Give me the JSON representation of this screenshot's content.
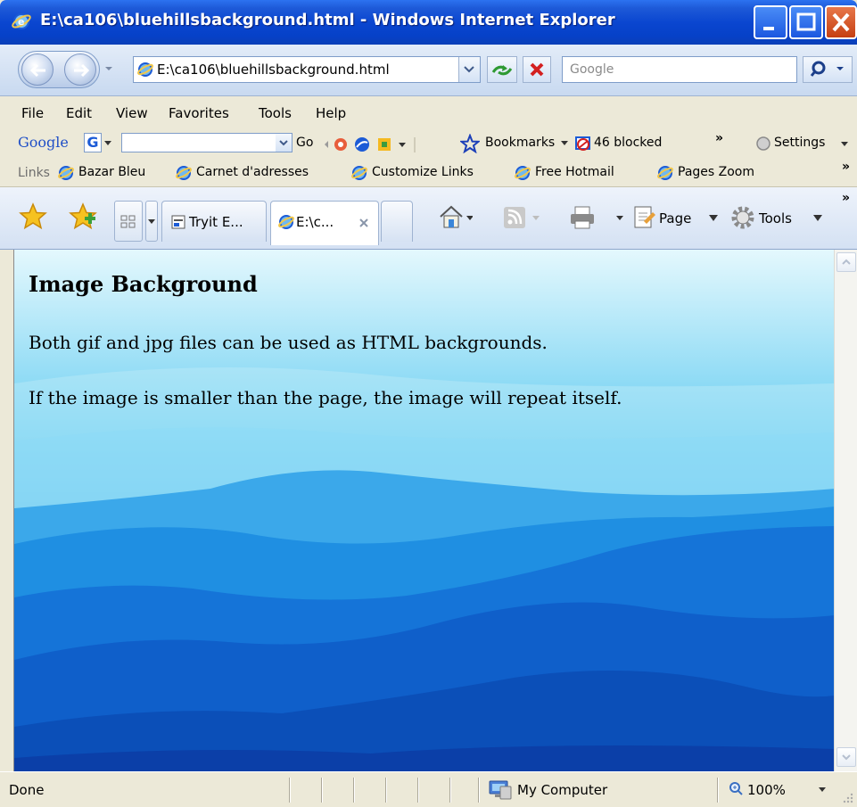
{
  "window": {
    "title": "E:\\ca106\\bluehillsbackground.html - Windows Internet Explorer"
  },
  "address": {
    "url": "E:\\ca106\\bluehillsbackground.html",
    "search_placeholder": "Google"
  },
  "menu": {
    "items": [
      "File",
      "Edit",
      "View",
      "Favorites",
      "Tools",
      "Help"
    ]
  },
  "google_toolbar": {
    "logo": "Google",
    "g_button": "G",
    "go_label": "Go",
    "bookmarks_label": "Bookmarks",
    "blocked_label": "46 blocked",
    "settings_label": "Settings"
  },
  "links": {
    "label": "Links",
    "items": [
      "Bazar Bleu",
      "Carnet d'adresses",
      "Customize Links",
      "Free Hotmail",
      "Pages Zoom"
    ]
  },
  "tabs": {
    "items": [
      {
        "label": "Tryit E..."
      },
      {
        "label": "E:\\c..."
      }
    ],
    "page_label": "Page",
    "tools_label": "Tools"
  },
  "page": {
    "heading": "Image Background",
    "paragraph1": "Both gif and jpg files can be used as HTML backgrounds.",
    "paragraph2": "If the image is smaller than the page, the image will repeat itself."
  },
  "status": {
    "text": "Done",
    "zone": "My Computer",
    "zoom": "100%"
  },
  "colors": {
    "titlebar": "#0a46d0",
    "sky_top": "#e4f8fd",
    "hills_dark": "#0b3fa8"
  }
}
